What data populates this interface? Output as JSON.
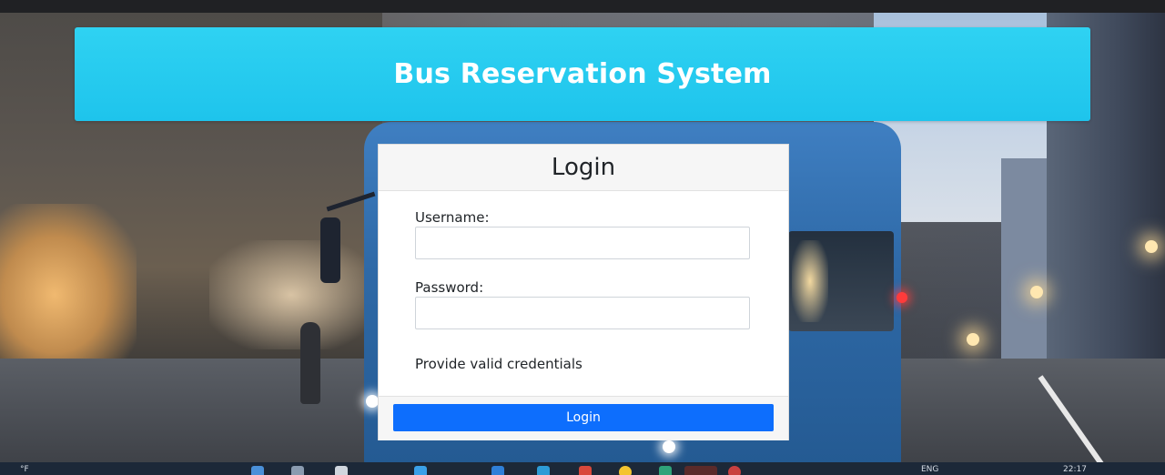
{
  "header": {
    "title": "Bus Reservation System"
  },
  "login": {
    "title": "Login",
    "username_label": "Username:",
    "username_value": "",
    "password_label": "Password:",
    "password_value": "",
    "message": "Provide valid credentials",
    "button_label": "Login"
  },
  "taskbar": {
    "weather_text": "°F",
    "lang_text": "ENG",
    "clock_text": "22:17"
  },
  "colors": {
    "banner": "#1ec4ec",
    "button": "#0d6efd"
  }
}
